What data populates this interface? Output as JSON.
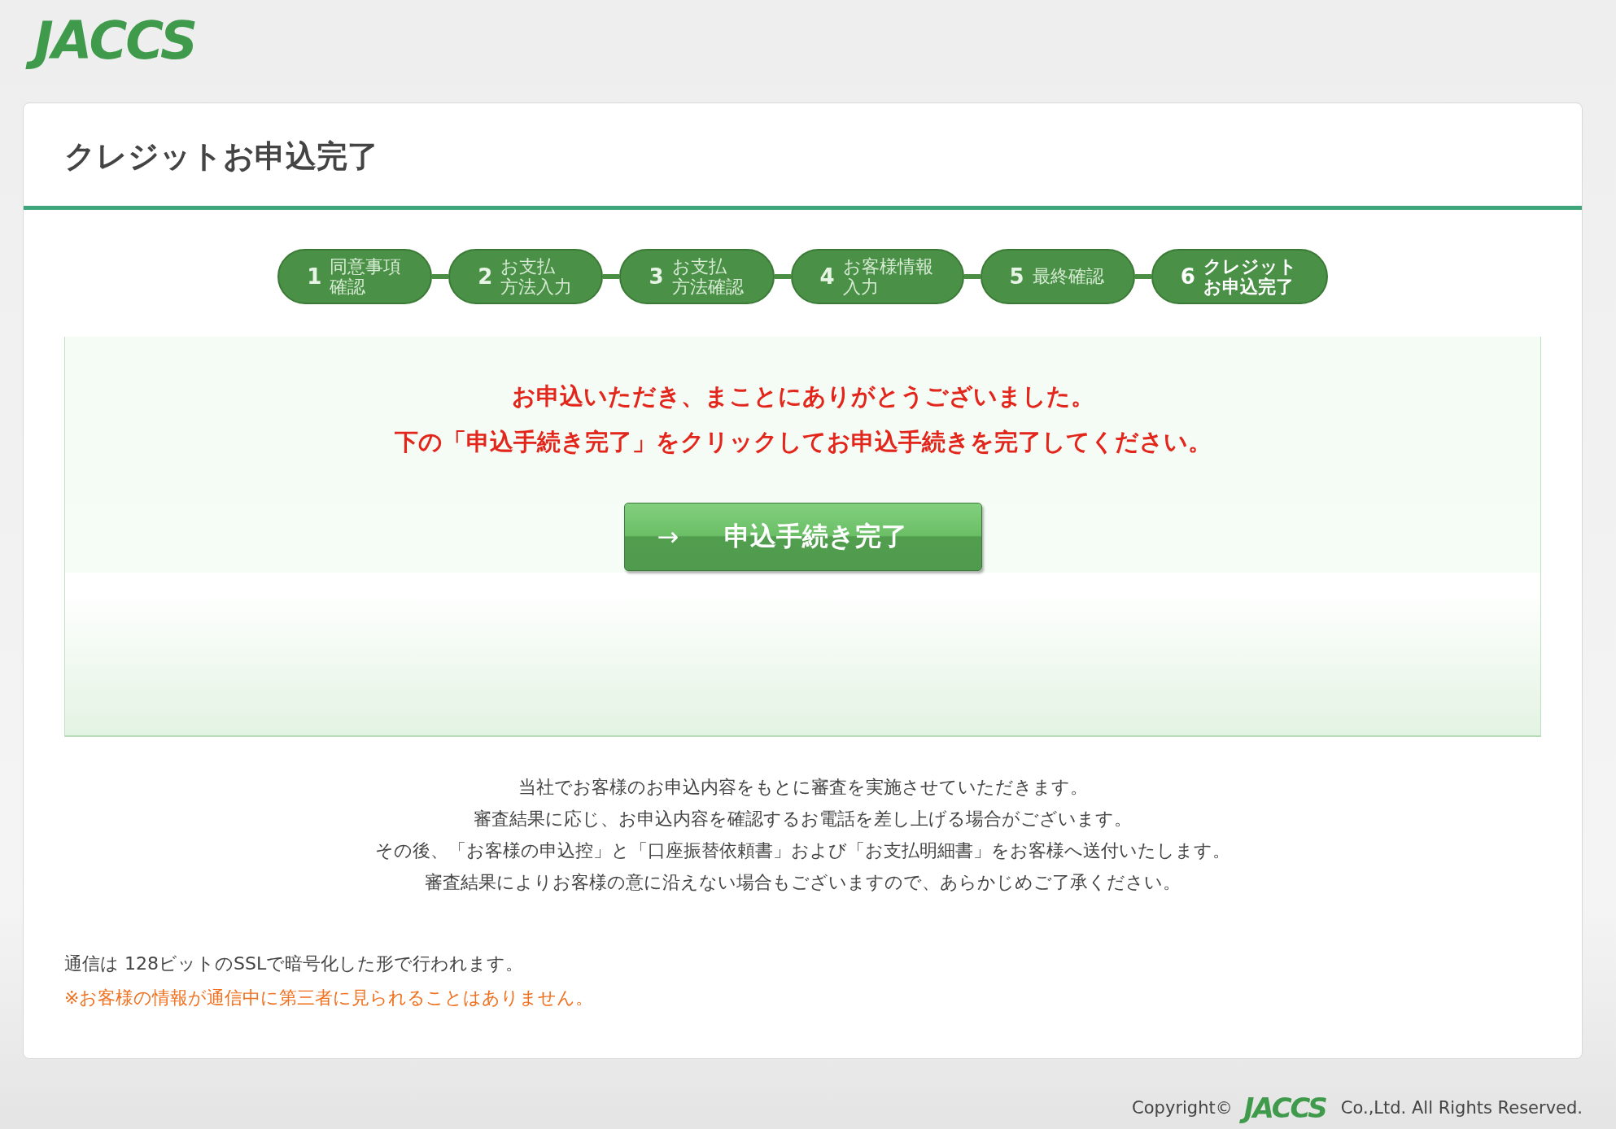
{
  "logo": {
    "text": "JACCS"
  },
  "page_title": "クレジットお申込完了",
  "steps": [
    {
      "number": "1",
      "label_lines": [
        "同意事項",
        "確認"
      ],
      "selected": false
    },
    {
      "number": "2",
      "label_lines": [
        "お支払",
        "方法入力"
      ],
      "selected": false
    },
    {
      "number": "3",
      "label_lines": [
        "お支払",
        "方法確認"
      ],
      "selected": false
    },
    {
      "number": "4",
      "label_lines": [
        "お客様情報",
        "入力"
      ],
      "selected": false
    },
    {
      "number": "5",
      "label_lines": [
        "最終確認"
      ],
      "selected": false
    },
    {
      "number": "6",
      "label_lines": [
        "クレジット",
        "お申込完了"
      ],
      "selected": true
    }
  ],
  "notice": [
    "お申込いただき、まことにありがとうございました。",
    "下の「申込手続き完了」をクリックしてお申込手続きを完了してください。"
  ],
  "complete_button": {
    "arrow": "→",
    "label": "申込手続き完了"
  },
  "info_lines": [
    "当社でお客様のお申込内容をもとに審査を実施させていただきます。",
    "審査結果に応じ、お申込内容を確認するお電話を差し上げる場合がございます。",
    "その後、「お客様の申込控」と「口座振替依頼書」および「お支払明細書」をお客様へ送付いたします。",
    "審査結果によりお客様の意に沿えない場合もございますので、あらかじめご了承ください。"
  ],
  "security_note": "通信は 128ビットのSSLで暗号化した形で行われます。",
  "security_warning": "※お客様の情報が通信中に第三者に見られることはありません。",
  "footer": {
    "copyright": "Copyright©",
    "logo": "JACCS",
    "company": "Co.,Ltd. All Rights Reserved."
  }
}
